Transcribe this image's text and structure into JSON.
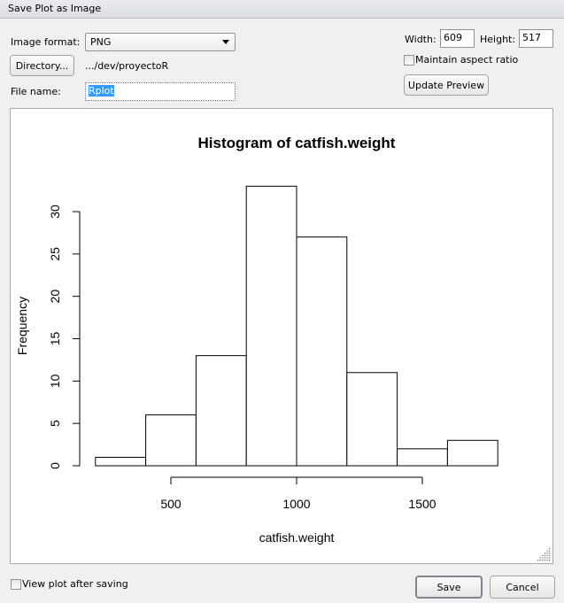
{
  "window": {
    "title": "Save Plot as Image"
  },
  "form": {
    "image_format_label": "Image format:",
    "image_format_value": "PNG",
    "directory_button": "Directory...",
    "directory_path": ".../dev/proyectoR",
    "file_name_label": "File name:",
    "file_name_value": "Rplot",
    "width_label": "Width:",
    "width_value": "609",
    "height_label": "Height:",
    "height_value": "517",
    "maintain_aspect_label": "Maintain aspect ratio",
    "maintain_aspect_checked": false,
    "update_preview_button": "Update Preview"
  },
  "footer": {
    "view_after_saving_label": "View plot after saving",
    "view_after_saving_checked": false,
    "save_button": "Save",
    "cancel_button": "Cancel"
  },
  "chart_data": {
    "type": "bar",
    "subtype": "histogram",
    "title": "Histogram of catfish.weight",
    "xlabel": "catfish.weight",
    "ylabel": "Frequency",
    "breaks": [
      200,
      400,
      600,
      800,
      1000,
      1200,
      1400,
      1600,
      1800
    ],
    "values": [
      1,
      6,
      13,
      33,
      27,
      11,
      2,
      3
    ],
    "x_ticks": [
      500,
      1000,
      1500
    ],
    "y_ticks": [
      0,
      5,
      10,
      15,
      20,
      25,
      30
    ],
    "xlim": [
      500,
      1500
    ],
    "ylim": [
      0,
      30
    ],
    "grid": false
  }
}
